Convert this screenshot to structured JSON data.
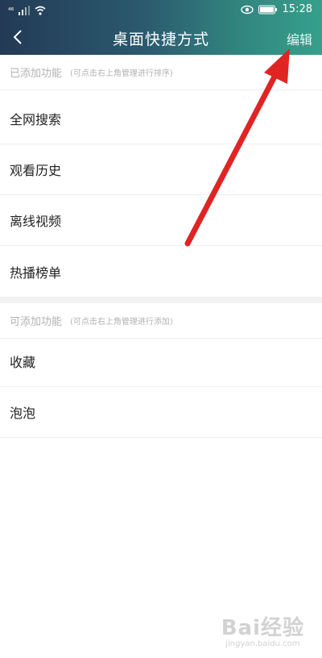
{
  "status_bar": {
    "signal": "⁴⁶",
    "time": "15:28"
  },
  "header": {
    "title": "桌面快捷方式",
    "edit_label": "编辑"
  },
  "added_section": {
    "label": "已添加功能",
    "hint": "(可点击右上角管理进行排序)",
    "items": [
      {
        "label": "全网搜索"
      },
      {
        "label": "观看历史"
      },
      {
        "label": "离线视频"
      },
      {
        "label": "热播榜单"
      }
    ]
  },
  "addable_section": {
    "label": "可添加功能",
    "hint": "(可点击右上角管理进行添加)",
    "items": [
      {
        "label": "收藏"
      },
      {
        "label": "泡泡"
      }
    ]
  },
  "annotation": {
    "arrow_color": "#e02424"
  },
  "watermark": {
    "main": "Bai经验",
    "sub": "jingyan.baidu.com"
  },
  "colors": {
    "header_start": "#233a55",
    "header_end": "#36a08c",
    "section_text": "#b2b2b2"
  }
}
